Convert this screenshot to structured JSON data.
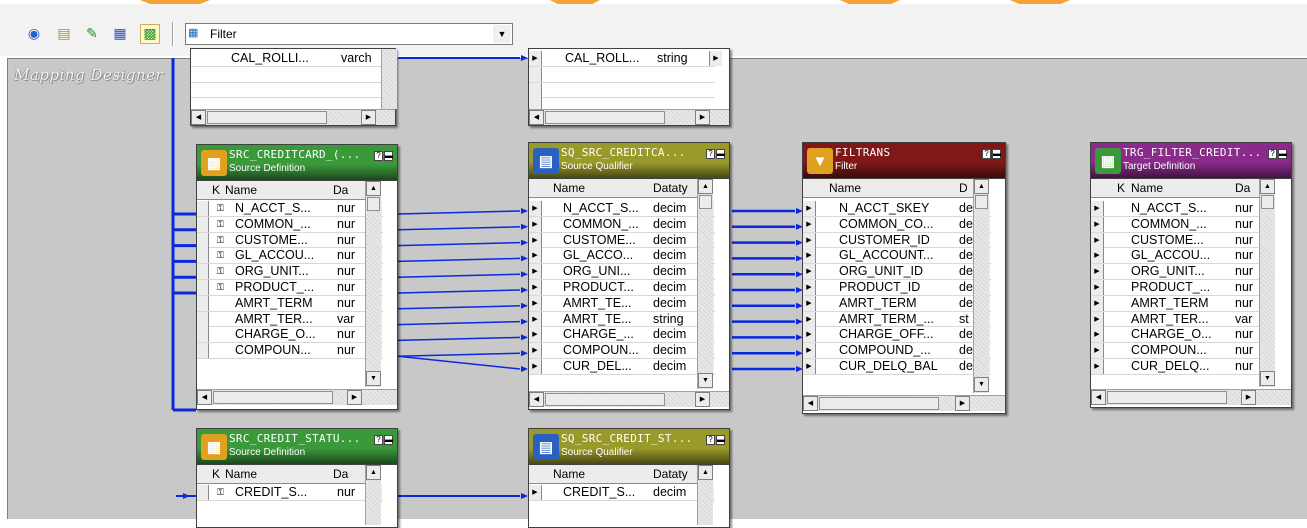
{
  "toolbar": {
    "icons": [
      "find-icon",
      "chart-icon",
      "edit-icon",
      "table-icon",
      "network-icon"
    ],
    "filter_select": {
      "icon": "filter-icon",
      "value": "Filter"
    }
  },
  "canvas": {
    "title": "Mapping Designer"
  },
  "colors": {
    "canvas": "#c8c8c8",
    "link": "#0a28e0",
    "source_definition": "#3a9a3a",
    "source_qualifier": "#9a9a2a",
    "filter": "#801818",
    "target_definition": "#8a2a8a"
  },
  "boxes": {
    "top_left": {
      "rows": [
        {
          "name": "CAL_ROLLI...",
          "datatype": "varch"
        }
      ]
    },
    "top_mid": {
      "rows": [
        {
          "name": "CAL_ROLL...",
          "datatype": "string"
        }
      ]
    },
    "src_creditcard": {
      "title": "SRC_CREDITCARD_(...",
      "subtitle": "Source Definition",
      "icon": "source-definition-icon",
      "columns": {
        "key": "K",
        "name": "Name",
        "datatype": "Da"
      },
      "rows": [
        {
          "key": true,
          "name": "N_ACCT_S...",
          "datatype": "nur"
        },
        {
          "key": true,
          "name": "COMMON_...",
          "datatype": "nur"
        },
        {
          "key": true,
          "name": "CUSTOME...",
          "datatype": "nur"
        },
        {
          "key": true,
          "name": "GL_ACCOU...",
          "datatype": "nur"
        },
        {
          "key": true,
          "name": "ORG_UNIT...",
          "datatype": "nur"
        },
        {
          "key": true,
          "name": "PRODUCT_...",
          "datatype": "nur"
        },
        {
          "key": false,
          "name": "AMRT_TERM",
          "datatype": "nur"
        },
        {
          "key": false,
          "name": "AMRT_TER...",
          "datatype": "var"
        },
        {
          "key": false,
          "name": "CHARGE_O...",
          "datatype": "nur"
        },
        {
          "key": false,
          "name": "COMPOUN...",
          "datatype": "nur"
        }
      ]
    },
    "sq_creditcard": {
      "title": "SQ_SRC_CREDITCA...",
      "subtitle": "Source Qualifier",
      "icon": "source-qualifier-icon",
      "columns": {
        "name": "Name",
        "datatype": "Dataty"
      },
      "rows": [
        {
          "name": "N_ACCT_S...",
          "datatype": "decim"
        },
        {
          "name": "COMMON_...",
          "datatype": "decim"
        },
        {
          "name": "CUSTOME...",
          "datatype": "decim"
        },
        {
          "name": "GL_ACCO...",
          "datatype": "decim"
        },
        {
          "name": "ORG_UNI...",
          "datatype": "decim"
        },
        {
          "name": "PRODUCT...",
          "datatype": "decim"
        },
        {
          "name": "AMRT_TE...",
          "datatype": "decim"
        },
        {
          "name": "AMRT_TE...",
          "datatype": "string"
        },
        {
          "name": "CHARGE_...",
          "datatype": "decim"
        },
        {
          "name": "COMPOUN...",
          "datatype": "decim"
        },
        {
          "name": "CUR_DEL...",
          "datatype": "decim"
        }
      ]
    },
    "filtrans": {
      "title": "FILTRANS",
      "subtitle": "Filter",
      "icon": "filter-transformation-icon",
      "columns": {
        "name": "Name",
        "datatype": "D"
      },
      "rows": [
        {
          "name": "N_ACCT_SKEY",
          "datatype": "de"
        },
        {
          "name": "COMMON_CO...",
          "datatype": "de"
        },
        {
          "name": "CUSTOMER_ID",
          "datatype": "de"
        },
        {
          "name": "GL_ACCOUNT...",
          "datatype": "de"
        },
        {
          "name": "ORG_UNIT_ID",
          "datatype": "de"
        },
        {
          "name": "PRODUCT_ID",
          "datatype": "de"
        },
        {
          "name": "AMRT_TERM",
          "datatype": "de"
        },
        {
          "name": "AMRT_TERM_...",
          "datatype": "st"
        },
        {
          "name": "CHARGE_OFF...",
          "datatype": "de"
        },
        {
          "name": "COMPOUND_...",
          "datatype": "de"
        },
        {
          "name": "CUR_DELQ_BAL",
          "datatype": "de"
        }
      ]
    },
    "trg_filter": {
      "title": "TRG_FILTER_CREDIT...",
      "subtitle": "Target Definition",
      "icon": "target-definition-icon",
      "columns": {
        "key": "K",
        "name": "Name",
        "datatype": "Da"
      },
      "rows": [
        {
          "name": "N_ACCT_S...",
          "datatype": "nur"
        },
        {
          "name": "COMMON_...",
          "datatype": "nur"
        },
        {
          "name": "CUSTOME...",
          "datatype": "nur"
        },
        {
          "name": "GL_ACCOU...",
          "datatype": "nur"
        },
        {
          "name": "ORG_UNIT...",
          "datatype": "nur"
        },
        {
          "name": "PRODUCT_...",
          "datatype": "nur"
        },
        {
          "name": "AMRT_TERM",
          "datatype": "nur"
        },
        {
          "name": "AMRT_TER...",
          "datatype": "var"
        },
        {
          "name": "CHARGE_O...",
          "datatype": "nur"
        },
        {
          "name": "COMPOUN...",
          "datatype": "nur"
        },
        {
          "name": "CUR_DELQ...",
          "datatype": "nur"
        }
      ]
    },
    "src_credit_status": {
      "title": "SRC_CREDIT_STATU...",
      "subtitle": "Source Definition",
      "icon": "source-definition-icon",
      "columns": {
        "key": "K",
        "name": "Name",
        "datatype": "Da"
      },
      "rows": [
        {
          "key": true,
          "name": "CREDIT_S...",
          "datatype": "nur"
        }
      ]
    },
    "sq_credit_status": {
      "title": "SQ_SRC_CREDIT_ST...",
      "subtitle": "Source Qualifier",
      "icon": "source-qualifier-icon",
      "columns": {
        "name": "Name",
        "datatype": "Dataty"
      },
      "rows": [
        {
          "name": "CREDIT_S...",
          "datatype": "decim"
        }
      ]
    }
  }
}
